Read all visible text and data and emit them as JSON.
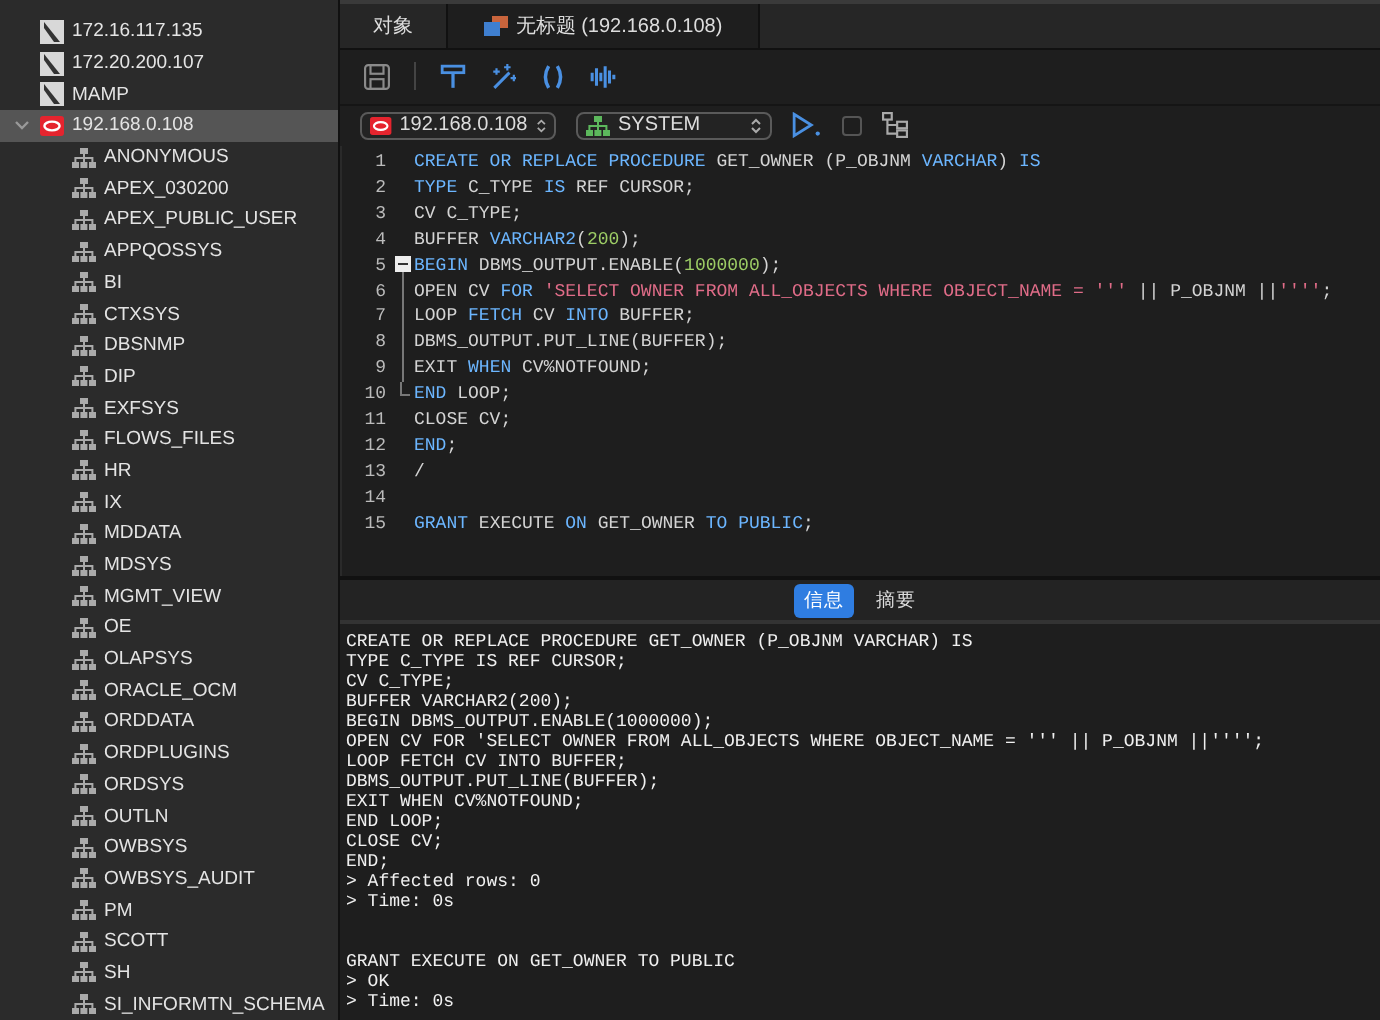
{
  "sidebar": {
    "connections": [
      {
        "label": "172.16.117.135",
        "kind": "mysql",
        "selected": false,
        "expanded": false
      },
      {
        "label": "172.20.200.107",
        "kind": "mysql",
        "selected": false,
        "expanded": false
      },
      {
        "label": "MAMP",
        "kind": "mysql",
        "selected": false,
        "expanded": false
      },
      {
        "label": "192.168.0.108",
        "kind": "oracle",
        "selected": true,
        "expanded": true,
        "children": [
          {
            "label": "ANONYMOUS"
          },
          {
            "label": "APEX_030200"
          },
          {
            "label": "APEX_PUBLIC_USER"
          },
          {
            "label": "APPQOSSYS"
          },
          {
            "label": "BI"
          },
          {
            "label": "CTXSYS"
          },
          {
            "label": "DBSNMP"
          },
          {
            "label": "DIP"
          },
          {
            "label": "EXFSYS"
          },
          {
            "label": "FLOWS_FILES"
          },
          {
            "label": "HR"
          },
          {
            "label": "IX"
          },
          {
            "label": "MDDATA"
          },
          {
            "label": "MDSYS"
          },
          {
            "label": "MGMT_VIEW"
          },
          {
            "label": "OE"
          },
          {
            "label": "OLAPSYS"
          },
          {
            "label": "ORACLE_OCM"
          },
          {
            "label": "ORDDATA"
          },
          {
            "label": "ORDPLUGINS"
          },
          {
            "label": "ORDSYS"
          },
          {
            "label": "OUTLN"
          },
          {
            "label": "OWBSYS"
          },
          {
            "label": "OWBSYS_AUDIT"
          },
          {
            "label": "PM"
          },
          {
            "label": "SCOTT"
          },
          {
            "label": "SH"
          },
          {
            "label": "SI_INFORMTN_SCHEMA"
          }
        ]
      }
    ]
  },
  "tabs": [
    {
      "label": "对象",
      "selected": false
    },
    {
      "label": "无标题 (192.168.0.108)",
      "selected": true
    }
  ],
  "connection_select": {
    "value": "192.168.0.108"
  },
  "schema_select": {
    "value": "SYSTEM"
  },
  "editor": {
    "lines": [
      {
        "number": "1",
        "tokens": [
          {
            "t": "CREATE OR REPLACE PROCEDURE",
            "kind": "keyword"
          },
          {
            "t": " GET_OWNER (P_OBJNM ",
            "kind": "plain"
          },
          {
            "t": "VARCHAR",
            "kind": "keyword"
          },
          {
            "t": ") ",
            "kind": "plain"
          },
          {
            "t": "IS",
            "kind": "keyword"
          }
        ]
      },
      {
        "number": "2",
        "tokens": [
          {
            "t": "TYPE",
            "kind": "keyword"
          },
          {
            "t": " C_TYPE ",
            "kind": "plain"
          },
          {
            "t": "IS",
            "kind": "keyword"
          },
          {
            "t": " REF CURSOR;",
            "kind": "plain"
          }
        ]
      },
      {
        "number": "3",
        "tokens": [
          {
            "t": "CV C_TYPE;",
            "kind": "plain"
          }
        ]
      },
      {
        "number": "4",
        "tokens": [
          {
            "t": "BUFFER ",
            "kind": "plain"
          },
          {
            "t": "VARCHAR2",
            "kind": "keyword"
          },
          {
            "t": "(",
            "kind": "plain"
          },
          {
            "t": "200",
            "kind": "number"
          },
          {
            "t": ");",
            "kind": "plain"
          }
        ]
      },
      {
        "number": "5",
        "fold_start": true,
        "tokens": [
          {
            "t": "BEGIN",
            "kind": "keyword"
          },
          {
            "t": " DBMS_OUTPUT.ENABLE(",
            "kind": "plain"
          },
          {
            "t": "1000000",
            "kind": "number"
          },
          {
            "t": ");",
            "kind": "plain"
          }
        ]
      },
      {
        "number": "6",
        "in_fold": true,
        "tokens": [
          {
            "t": "OPEN CV ",
            "kind": "plain"
          },
          {
            "t": "FOR",
            "kind": "keyword"
          },
          {
            "t": " 'SELECT OWNER FROM ALL_OBJECTS WHERE OBJECT_NAME = '''",
            "kind": "string"
          },
          {
            "t": " || P_OBJNM ||",
            "kind": "plain"
          },
          {
            "t": "''''",
            "kind": "string"
          },
          {
            "t": ";",
            "kind": "plain"
          }
        ]
      },
      {
        "number": "7",
        "in_fold": true,
        "tokens": [
          {
            "t": "LOOP ",
            "kind": "plain"
          },
          {
            "t": "FETCH",
            "kind": "keyword"
          },
          {
            "t": " CV ",
            "kind": "plain"
          },
          {
            "t": "INTO",
            "kind": "keyword"
          },
          {
            "t": " BUFFER;",
            "kind": "plain"
          }
        ]
      },
      {
        "number": "8",
        "in_fold": true,
        "tokens": [
          {
            "t": "DBMS_OUTPUT.PUT_LINE(BUFFER);",
            "kind": "plain"
          }
        ]
      },
      {
        "number": "9",
        "in_fold": true,
        "tokens": [
          {
            "t": "EXIT ",
            "kind": "plain"
          },
          {
            "t": "WHEN",
            "kind": "keyword"
          },
          {
            "t": " CV%NOTFOUND;",
            "kind": "plain"
          }
        ]
      },
      {
        "number": "10",
        "fold_end": true,
        "tokens": [
          {
            "t": "END",
            "kind": "keyword"
          },
          {
            "t": " LOOP;",
            "kind": "plain"
          }
        ]
      },
      {
        "number": "11",
        "tokens": [
          {
            "t": "CLOSE CV;",
            "kind": "plain"
          }
        ]
      },
      {
        "number": "12",
        "tokens": [
          {
            "t": "END",
            "kind": "keyword"
          },
          {
            "t": ";",
            "kind": "plain"
          }
        ]
      },
      {
        "number": "13",
        "tokens": [
          {
            "t": "/",
            "kind": "plain"
          }
        ]
      },
      {
        "number": "14"
      },
      {
        "number": "15",
        "tokens": [
          {
            "t": "GRANT",
            "kind": "keyword"
          },
          {
            "t": " EXECUTE ",
            "kind": "plain"
          },
          {
            "t": "ON",
            "kind": "keyword"
          },
          {
            "t": " GET_OWNER ",
            "kind": "plain"
          },
          {
            "t": "TO",
            "kind": "keyword"
          },
          {
            "t": " PUBLIC",
            "kind": "keyword"
          },
          {
            "t": ";",
            "kind": "plain"
          }
        ]
      }
    ]
  },
  "result_tabs": [
    {
      "label": "信息",
      "selected": true
    },
    {
      "label": "摘要",
      "selected": false
    }
  ],
  "output": {
    "blocks": [
      {
        "lines": [
          "CREATE OR REPLACE PROCEDURE GET_OWNER (P_OBJNM VARCHAR) IS",
          "TYPE C_TYPE IS REF CURSOR;",
          "CV C_TYPE;",
          "BUFFER VARCHAR2(200);",
          "BEGIN DBMS_OUTPUT.ENABLE(1000000);",
          "OPEN CV FOR 'SELECT OWNER FROM ALL_OBJECTS WHERE OBJECT_NAME = ''' || P_OBJNM ||'''';",
          "LOOP FETCH CV INTO BUFFER;",
          "DBMS_OUTPUT.PUT_LINE(BUFFER);",
          "EXIT WHEN CV%NOTFOUND;",
          "END LOOP;",
          "CLOSE CV;",
          "END;",
          "> Affected rows: 0",
          "> Time: 0s"
        ]
      },
      {
        "lines": [
          "GRANT EXECUTE ON GET_OWNER TO PUBLIC",
          "> OK",
          "> Time: 0s"
        ]
      }
    ]
  }
}
